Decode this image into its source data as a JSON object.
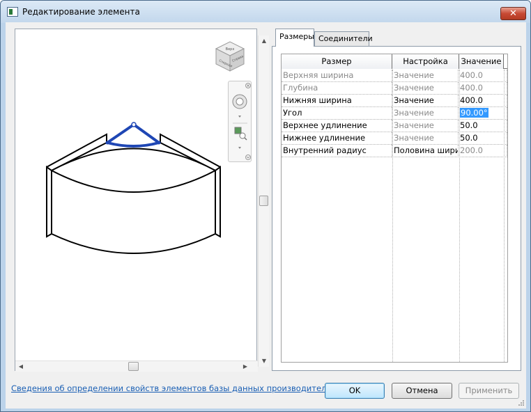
{
  "window": {
    "title": "Редактирование элемента",
    "close_label": "✕"
  },
  "tabs": [
    {
      "label": "Размеры",
      "active": true
    },
    {
      "label": "Соединители",
      "active": false
    }
  ],
  "grid": {
    "headers": [
      "Размер",
      "Настройка",
      "Значение"
    ],
    "rows": [
      {
        "name": "Верхняя ширина",
        "setting": "Значение",
        "value": "400.0",
        "name_grey": true,
        "setting_grey": true,
        "value_grey": true
      },
      {
        "name": "Глубина",
        "setting": "Значение",
        "value": "400.0",
        "name_grey": true,
        "setting_grey": true,
        "value_grey": true
      },
      {
        "name": "Нижняя ширина",
        "setting": "Значение",
        "value": "400.0",
        "name_grey": false,
        "setting_grey": false,
        "value_grey": false
      },
      {
        "name": "Угол",
        "setting": "Значение",
        "value": "90.00°",
        "name_grey": false,
        "setting_grey": true,
        "value_grey": false,
        "value_selected": true
      },
      {
        "name": "Верхнее удлинение",
        "setting": "Значение",
        "value": "50.0",
        "name_grey": false,
        "setting_grey": true,
        "value_grey": false
      },
      {
        "name": "Нижнее удлинение",
        "setting": "Значение",
        "value": "50.0",
        "name_grey": false,
        "setting_grey": true,
        "value_grey": false
      },
      {
        "name": "Внутренний радиус",
        "setting": "Половина шири",
        "value": "200.0",
        "name_grey": false,
        "setting_grey": false,
        "value_grey": true
      }
    ]
  },
  "viewcube": {
    "face_top": "Верх",
    "face_front": "Спереди",
    "face_right": "Справа"
  },
  "footer": {
    "link": "Сведения об определении свойств элементов базы данных производителя",
    "ok": "OK",
    "cancel": "Отмена",
    "apply": "Применить"
  },
  "colors": {
    "selection": "#3399ff",
    "angle_marker": "#1e46b4",
    "link": "#1a5fb4"
  }
}
